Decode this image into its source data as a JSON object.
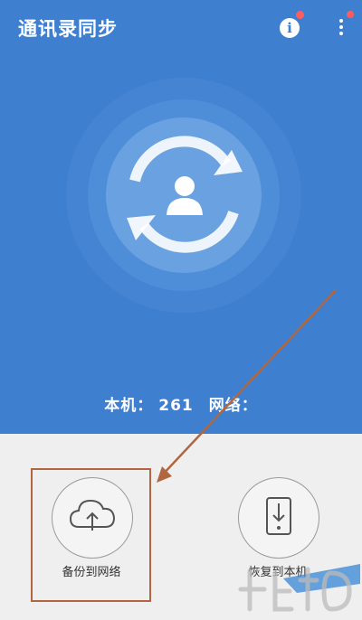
{
  "header": {
    "title": "通讯录同步",
    "icons": {
      "info": "info-icon",
      "menu": "more-vert-icon"
    },
    "badge_color": "#ff5d5d",
    "background_color": "#3f7fd0"
  },
  "status": {
    "local_label": "本机：",
    "local_count": "261",
    "network_label": "网络："
  },
  "actions": [
    {
      "label": "备份到网络",
      "icon": "cloud-upload-icon"
    },
    {
      "label": "恢复到本机",
      "icon": "phone-download-icon"
    }
  ],
  "annotation_color": "#b0673f"
}
